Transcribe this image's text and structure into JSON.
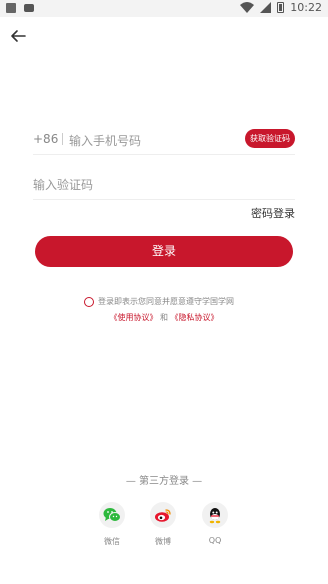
{
  "status_bar": {
    "time": "10:22"
  },
  "login": {
    "country_code": "+86",
    "phone_placeholder": "输入手机号码",
    "get_code_label": "获取验证码",
    "code_placeholder": "输入验证码",
    "password_login_label": "密码登录",
    "login_button_label": "登录"
  },
  "agreement": {
    "text": "登录即表示您同意并愿意遵守学国学网",
    "user_agreement": "《使用协议》",
    "connector": "和",
    "privacy_agreement": "《隐私协议》"
  },
  "third_party": {
    "title": "— 第三方登录 —",
    "providers": [
      {
        "label": "微信",
        "icon": "wechat-icon",
        "color": "#2db83d"
      },
      {
        "label": "微博",
        "icon": "weibo-icon",
        "color": "#e6162d"
      },
      {
        "label": "QQ",
        "icon": "qq-icon",
        "color": "#111111"
      }
    ]
  },
  "colors": {
    "accent": "#c8172c"
  }
}
